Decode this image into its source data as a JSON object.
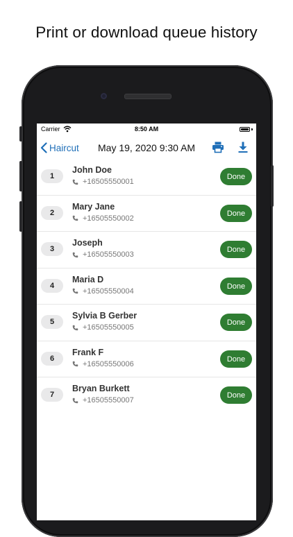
{
  "caption": "Print or download queue history",
  "status_bar": {
    "carrier": "Carrier",
    "time": "8:50 AM"
  },
  "nav": {
    "back_label": "Haircut",
    "title": "May 19, 2020 9:30 AM",
    "print_icon": "print-icon",
    "download_icon": "download-icon"
  },
  "accent_color": "#1f6fb8",
  "done_color": "#2f7d32",
  "queue": [
    {
      "number": "1",
      "name": "John Doe",
      "phone": "+16505550001",
      "action": "Done"
    },
    {
      "number": "2",
      "name": "Mary Jane",
      "phone": "+16505550002",
      "action": "Done"
    },
    {
      "number": "3",
      "name": "Joseph",
      "phone": "+16505550003",
      "action": "Done"
    },
    {
      "number": "4",
      "name": "Maria D",
      "phone": "+16505550004",
      "action": "Done"
    },
    {
      "number": "5",
      "name": "Sylvia B Gerber",
      "phone": "+16505550005",
      "action": "Done"
    },
    {
      "number": "6",
      "name": "Frank F",
      "phone": "+16505550006",
      "action": "Done"
    },
    {
      "number": "7",
      "name": "Bryan Burkett",
      "phone": "+16505550007",
      "action": "Done"
    }
  ]
}
